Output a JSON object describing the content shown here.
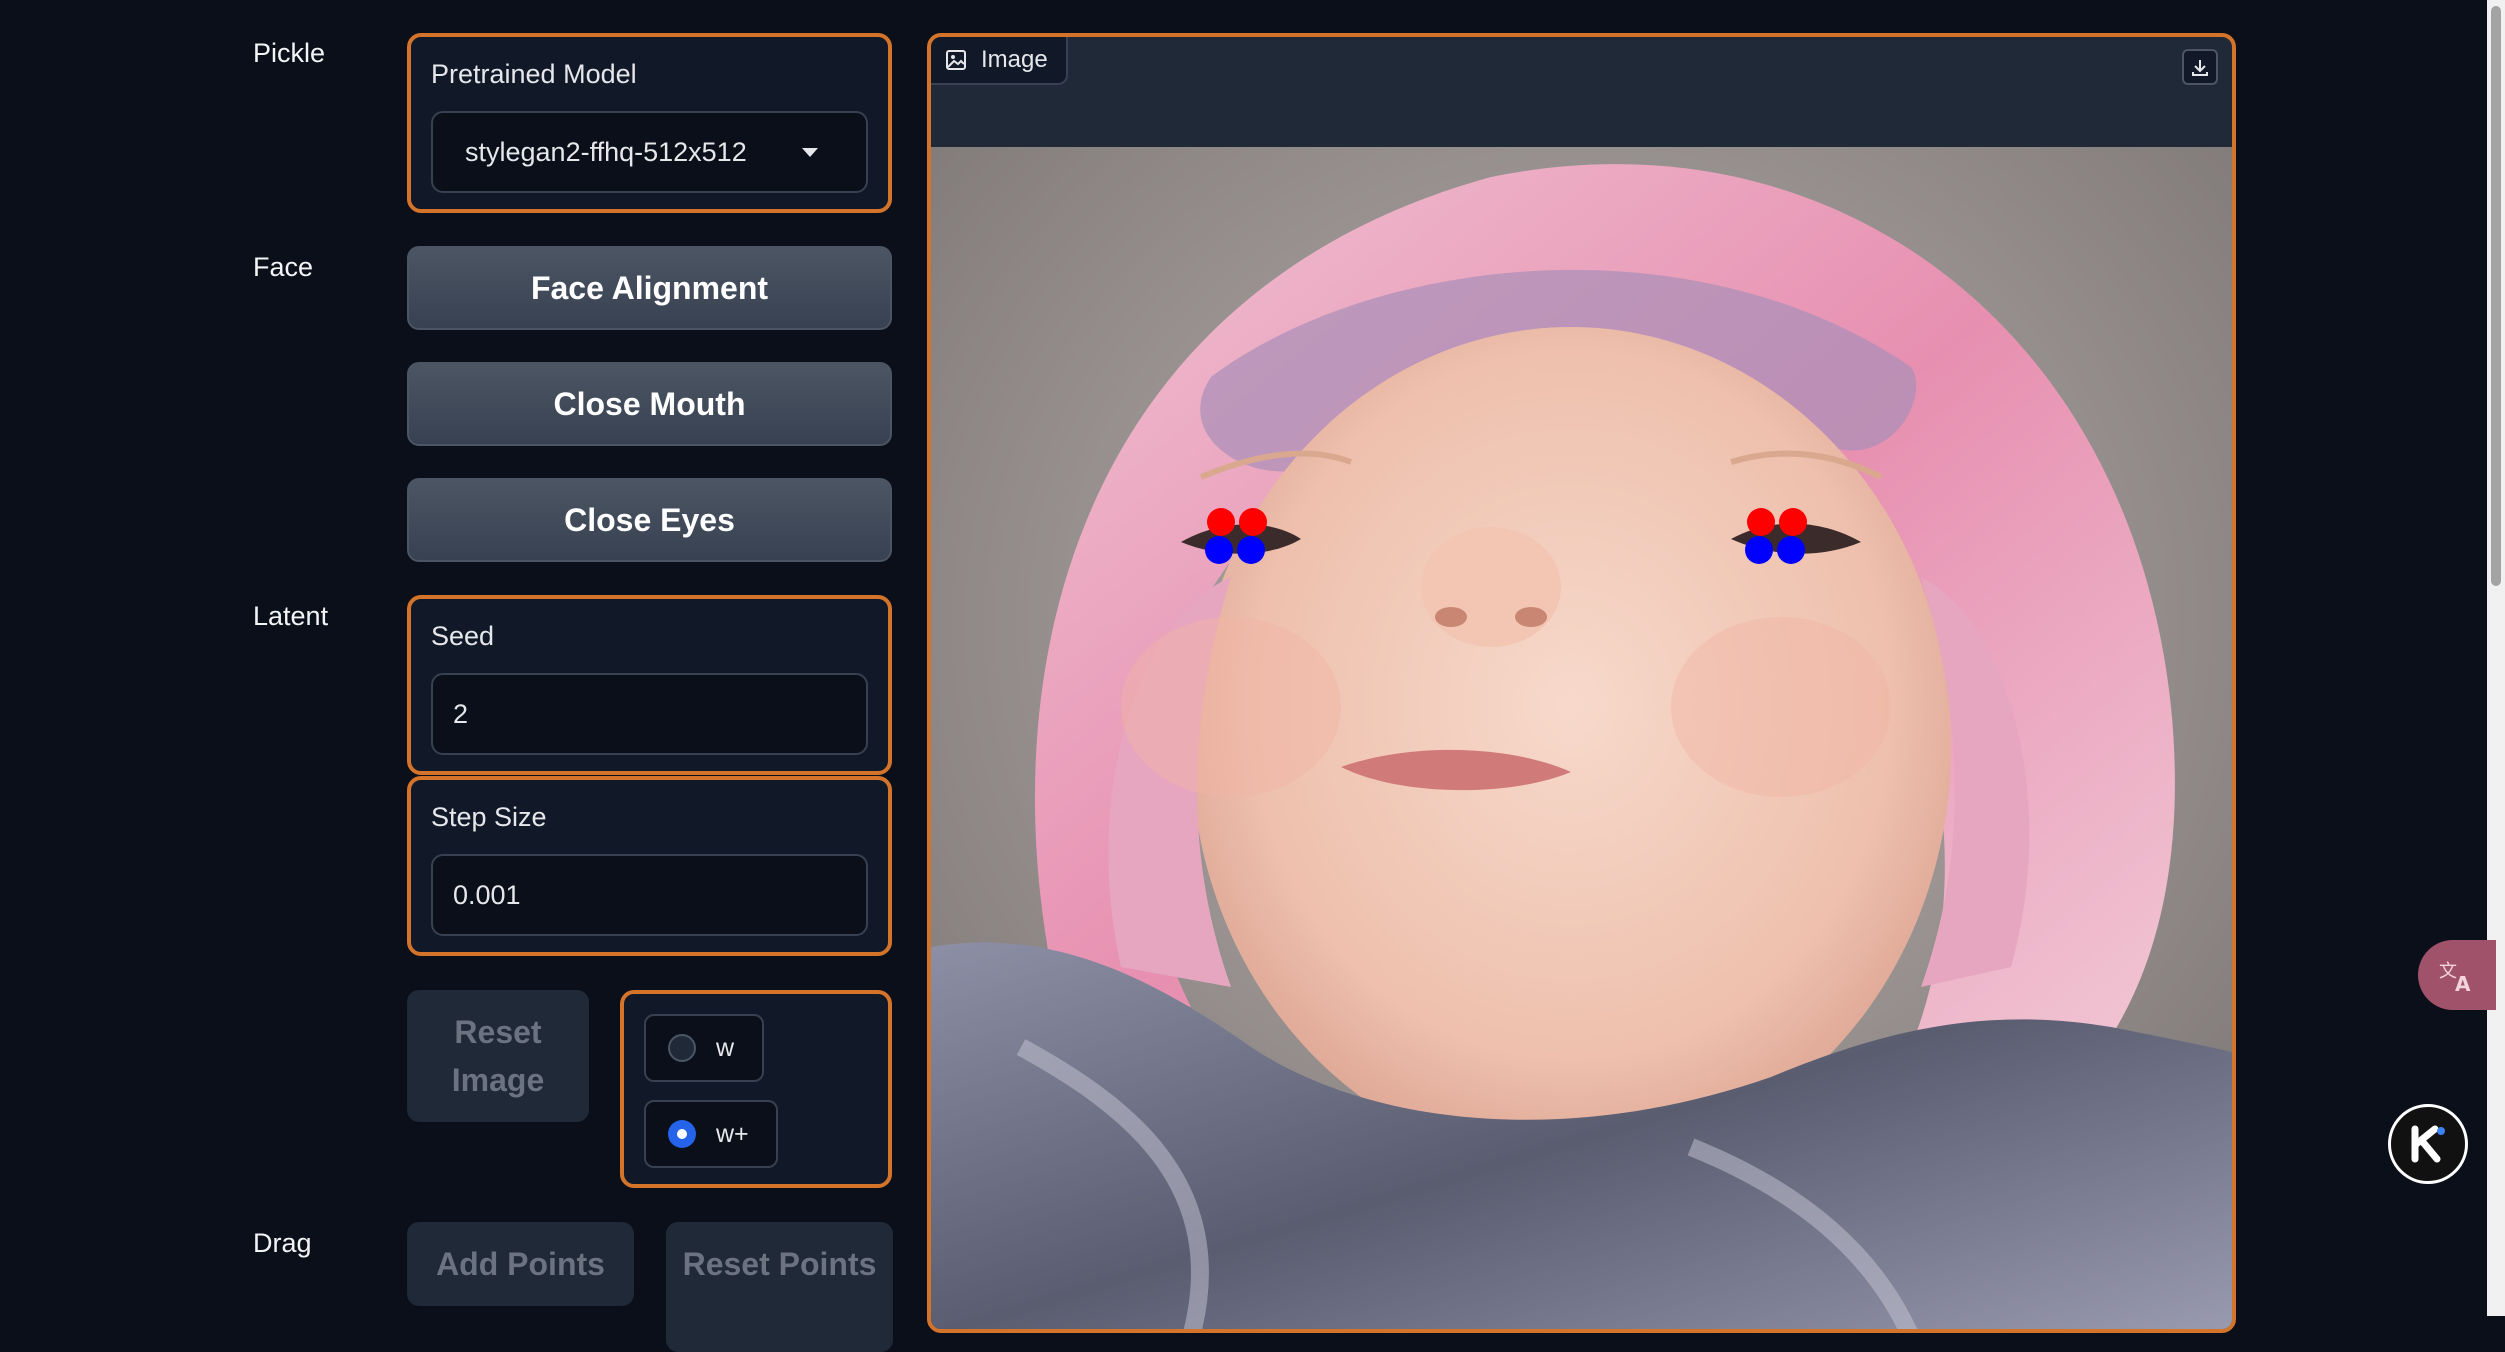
{
  "sections": {
    "pickle": "Pickle",
    "face": "Face",
    "latent": "Latent",
    "drag": "Drag"
  },
  "pickle": {
    "model_label": "Pretrained Model",
    "model_value": "stylegan2-ffhq-512x512"
  },
  "face": {
    "face_alignment": "Face Alignment",
    "close_mouth": "Close Mouth",
    "close_eyes": "Close Eyes"
  },
  "latent": {
    "seed_label": "Seed",
    "seed_value": "2",
    "step_label": "Step Size",
    "step_value": "0.001",
    "reset_image": "Reset Image",
    "space_options": [
      {
        "label": "w",
        "checked": false
      },
      {
        "label": "w+",
        "checked": true
      }
    ]
  },
  "drag": {
    "add_points": "Add Points",
    "reset_points": "Reset Points"
  },
  "image": {
    "tab_label": "Image",
    "point_colors": {
      "handle": "#ff0000",
      "target": "#0000ff"
    }
  },
  "colors": {
    "accent": "#d4732a",
    "background": "#0b0f19",
    "panel": "#111827",
    "radio_checked": "#2563eb"
  },
  "icons": [
    "image-icon",
    "download-icon",
    "dropdown-caret-icon",
    "translate-icon",
    "k-logo-icon"
  ]
}
